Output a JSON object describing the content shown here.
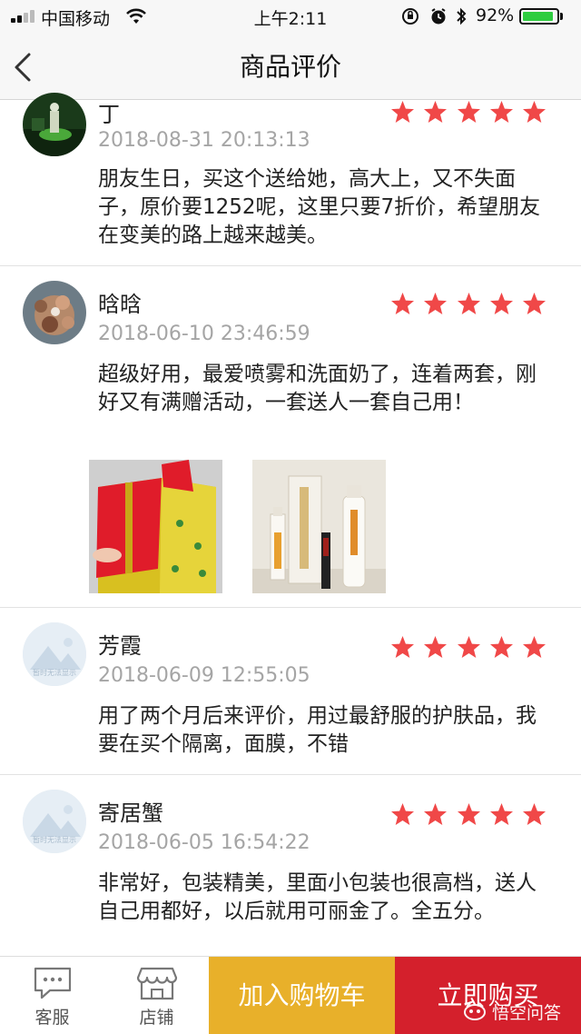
{
  "status_bar": {
    "carrier": "中国移动",
    "time": "上午2:11",
    "battery": "92%",
    "battery_level": 0.92
  },
  "nav": {
    "title": "商品评价"
  },
  "colors": {
    "star": "#f04848",
    "cart_button": "#e8b02a",
    "buy_button": "#d4202c"
  },
  "reviews": [
    {
      "username": "丁",
      "rating": 5,
      "date": "2018-08-31 20:13:13",
      "content": "朋友生日，买这个送给她，高大上，又不失面子，原价要1252呢，这里只要7折价，希望朋友在变美的路上越来越美。"
    },
    {
      "username": "晗晗",
      "rating": 5,
      "date": "2018-06-10 23:46:59",
      "content": "超级好用，最爱喷雾和洗面奶了，连着两套，刚好又有满赠活动，一套送人一套自己用！"
    },
    {
      "username": "芳霞",
      "rating": 5,
      "date": "2018-06-09 12:55:05",
      "content": "用了两个月后来评价，用过最舒服的护肤品，我要在买个隔离，面膜，不错"
    },
    {
      "username": "寄居蟹",
      "rating": 5,
      "date": "2018-06-05 16:54:22",
      "content": "非常好，包装精美，里面小包装也很高档，送人自己用都好，以后就用可丽金了。全五分。"
    }
  ],
  "placeholder_avatar_text": "暂时无法显示",
  "bottom_bar": {
    "service_label": "客服",
    "shop_label": "店铺",
    "cart_label": "加入购物车",
    "buy_label": "立即购买"
  },
  "watermark": "悟空问答"
}
